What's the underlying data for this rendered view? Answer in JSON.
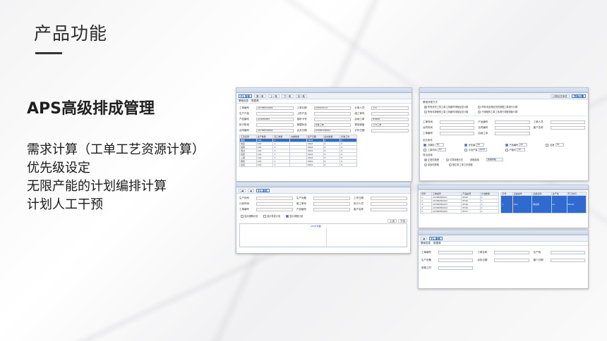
{
  "slide": {
    "title": "产品功能",
    "section_heading": "APS高级排成管理",
    "features": [
      "需求计算（工单工艺资源计算）",
      "优先级设定",
      "无限产能的计划编排计算",
      "计划人工干预"
    ]
  },
  "screens": {
    "work_order": {
      "toolbar": [
        "F1 查询",
        "第一条",
        "上一条",
        "下一条",
        "末一条"
      ],
      "tabs": [
        "基础信息",
        "数据源"
      ],
      "fields": [
        {
          "label": "工单编号",
          "value": "2076BTO0069"
        },
        {
          "label": "工单日期",
          "value": "2019/05/14"
        },
        {
          "label": "计单人员",
          "value": "111"
        },
        {
          "label": "生产产品",
          "value": ""
        },
        {
          "label": "上阶产品",
          "value": ""
        },
        {
          "label": "组工单号",
          "value": ""
        },
        {
          "label": "产品编号",
          "value": "A04089987"
        },
        {
          "label": "指析卡号",
          "value": ""
        },
        {
          "label": "后续工单",
          "value": "BTBZE"
        },
        {
          "label": "执行阶段",
          "value": ""
        },
        {
          "label": "单据状态",
          "value": "待审工单"
        },
        {
          "label": "紧急程度",
          "value": "公开工单"
        },
        {
          "label": "合同编号",
          "value": "2076BTO8692"
        },
        {
          "label": "合并日期",
          "value": "2076BTO8692"
        },
        {
          "label": "计件日期",
          "value": ""
        }
      ],
      "table_header": [
        "工序名称",
        "生产数量",
        "完工数量",
        "在制数量",
        "生产日期",
        "指派数量",
        "标准工时"
      ],
      "table_rows": [
        [
          "备料",
          "100",
          "1",
          "",
          "0001",
          "0",
          "0"
        ],
        [
          "焊接",
          "100",
          "1",
          "",
          "0001",
          "0",
          "0"
        ],
        [
          "组装",
          "100",
          "1",
          "",
          "0001",
          "0",
          "0"
        ],
        [
          "测试",
          "100",
          "1",
          "",
          "0001",
          "0",
          "0"
        ],
        [
          "包装",
          "100",
          "1",
          "",
          "0001",
          "0",
          "0"
        ],
        [
          "入库",
          "100",
          "1",
          "",
          "0001",
          "0",
          "0"
        ],
        [
          "质检",
          "100",
          "1",
          "",
          "0001",
          "0",
          "0"
        ],
        [
          "出货",
          "100",
          "1",
          "",
          "0001",
          "0",
          "0"
        ]
      ]
    },
    "schedule_method": {
      "toolbar": [
        "计算优先条件",
        "开始计算"
      ],
      "group_title": "基础排程方式",
      "options": [
        "所有未完工的工单工序都作排程反复计算",
        "所有未定按优先的排程工单进行计算",
        "所有未排程的工单工序都作排程反复计算",
        "只排程的工单工序进行排程重新计算"
      ],
      "fields": [
        {
          "label": "工单时间",
          "value": ""
        },
        {
          "label": "产品编号",
          "value": ""
        },
        {
          "label": "工单人员",
          "value": ""
        },
        {
          "label": "合同时间",
          "value": ""
        },
        {
          "label": "合同编号",
          "value": ""
        },
        {
          "label": "客户名称",
          "value": ""
        },
        {
          "label": "工单编号",
          "value": ""
        },
        {
          "label": "后续工序",
          "value": ""
        }
      ],
      "priority_title": "优先条件",
      "checks": [
        {
          "label": "交期前",
          "value": "30"
        },
        {
          "label": "优先级",
          "value": "80"
        },
        {
          "label": "产品编号",
          "value": "60"
        },
        {
          "label": "加班",
          "value": "30"
        },
        {
          "label": "工单时间",
          "value": "50"
        },
        {
          "label": "计划产量",
          "value": "2000"
        },
        {
          "label": "产能时",
          "value": "30"
        }
      ],
      "calc_title": "排出选择",
      "calc_options": [
        "正常的排程",
        "引导排程方式",
        "逆序的排程",
        "按正常工单工作排程"
      ],
      "mode_label": "排程选择",
      "mode_value": "前期排程"
    },
    "plan_query": {
      "toolbar": [
        "F1 查询"
      ],
      "fields": [
        {
          "label": "生产线号",
          "value": ""
        },
        {
          "label": "生产设备",
          "value": ""
        },
        {
          "label": "工作日期",
          "value": ""
        },
        {
          "label": "计划时间",
          "value": ""
        },
        {
          "label": "组工单号",
          "value": ""
        },
        {
          "label": "执行人员",
          "value": ""
        },
        {
          "label": "工单编号",
          "value": ""
        },
        {
          "label": "产品编号",
          "value": ""
        },
        {
          "label": "客户名称",
          "value": ""
        }
      ],
      "checks": [
        "显示超期计划",
        "显示有变计划",
        "显示排程计划"
      ],
      "buttons": [
        "上页",
        "下页"
      ],
      "chart_label": "APS计划图"
    },
    "dispatch": {
      "left_header": [
        "序号",
        "工单编号",
        "产品编号",
        "计划数量"
      ],
      "left_rows": [
        [
          "1",
          "2076BT80001",
          "BT45",
          "1"
        ],
        [
          "2",
          "2076BT80002",
          "BT45",
          "1"
        ],
        [
          "3",
          "2076BT80003",
          "BT46",
          "1"
        ],
        [
          "4",
          "2076BT80004",
          "BT46",
          "1"
        ],
        [
          "5",
          "2076BT80005",
          "BT47",
          "1"
        ]
      ],
      "right_header": [
        "序号",
        "设备编号",
        "设备名称",
        "生产线",
        "开工时间"
      ],
      "right_rows": [
        [
          "1",
          "A01",
          "焊接机",
          "L1",
          "08:00"
        ]
      ]
    },
    "resource": {
      "toolbar": [
        "F1 查询"
      ],
      "tabs": [
        "基础信息",
        "数据源"
      ],
      "fields": [
        {
          "label": "工单编号",
          "value": ""
        },
        {
          "label": "工单名称",
          "value": ""
        },
        {
          "label": "生产线",
          "value": ""
        },
        {
          "label": "生产设备",
          "value": ""
        },
        {
          "label": "目标日期",
          "value": ""
        },
        {
          "label": "最少日期",
          "value": ""
        },
        {
          "label": "制造工时",
          "value": ""
        }
      ]
    }
  }
}
